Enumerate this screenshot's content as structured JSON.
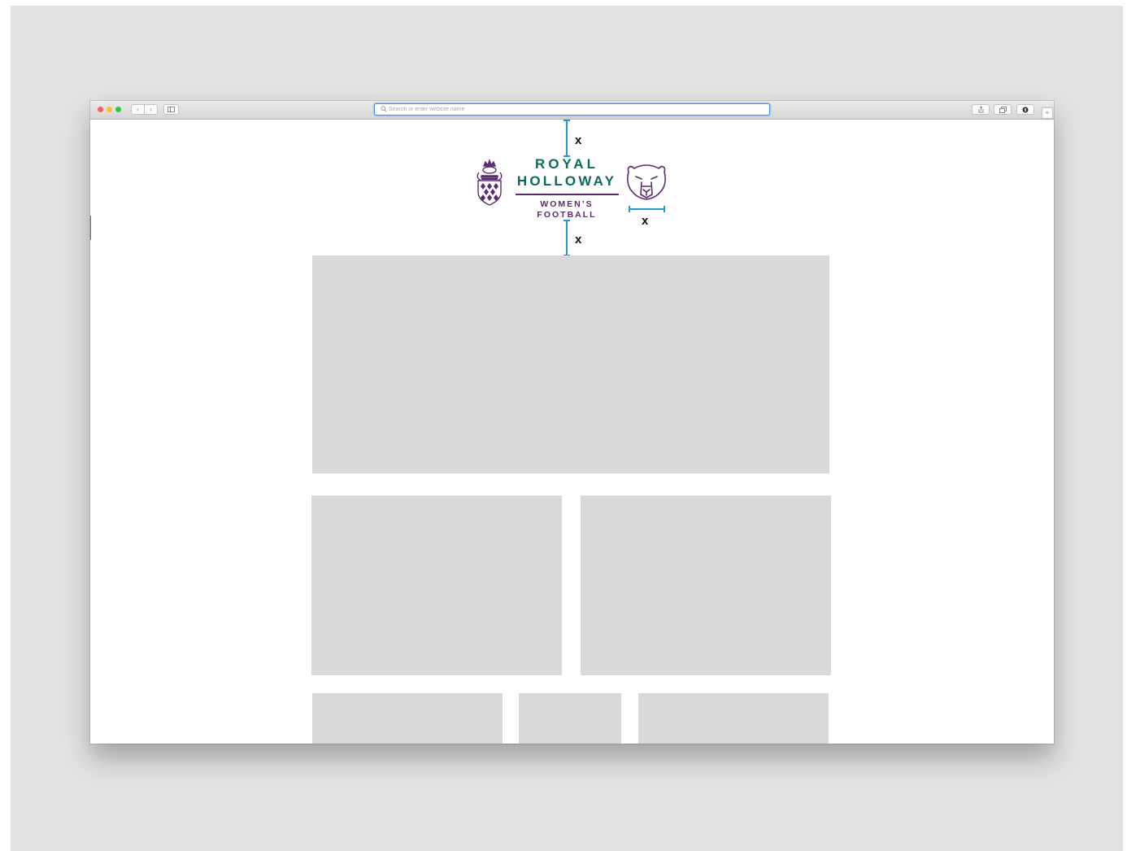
{
  "browser": {
    "address_placeholder": "Search or enter website name",
    "traffic_lights": [
      "#fc5f57",
      "#fdbc2e",
      "#28c840"
    ],
    "icons": {
      "back": "chevron-left-icon",
      "forward": "chevron-right-icon",
      "sidebar": "sidebar-icon",
      "search": "magnifier-icon",
      "share": "share-icon",
      "tabs": "tabs-overview-icon",
      "extension": "extension-icon",
      "new_tab": "plus-icon"
    }
  },
  "logo": {
    "line1": "ROYAL",
    "line2": "HOLLOWAY",
    "line3": "WOMEN’S",
    "line4": "FOOTBALL",
    "colors": {
      "green": "#0e6a5b",
      "purple": "#5c2a6e"
    },
    "icons": {
      "crest": "crest-icon",
      "bear": "bear-head-icon"
    }
  },
  "measurements": {
    "label": "x",
    "color": "#1f9ad6"
  },
  "placeholders": {
    "color": "#d9d9d9"
  }
}
